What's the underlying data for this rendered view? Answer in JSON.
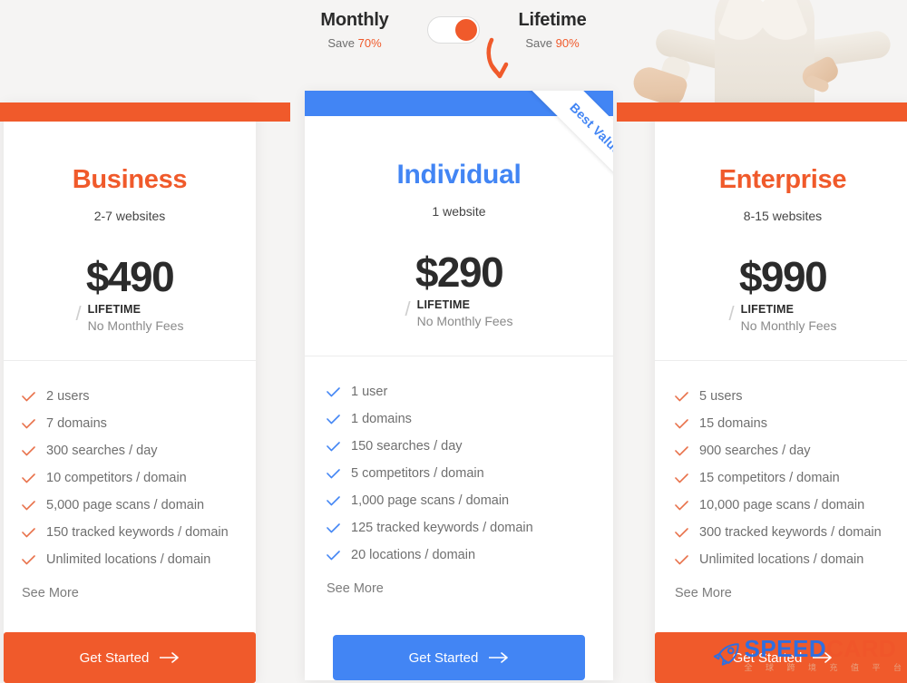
{
  "header": {
    "monthly": {
      "name": "Monthly",
      "save_prefix": "Save ",
      "save_pct": "70%"
    },
    "lifetime": {
      "name": "Lifetime",
      "save_prefix": "Save ",
      "save_pct": "90%"
    },
    "toggle_state": "lifetime"
  },
  "colors": {
    "orange": "#f05a2b",
    "blue": "#4285f4",
    "page_bg": "#f5f4f3",
    "card_bg": "#ffffff",
    "feature_text": "#6f6f6f"
  },
  "ribbon": {
    "label": "Best Value"
  },
  "cards": [
    {
      "name": "Business",
      "websites": "2-7 websites",
      "price": "$490",
      "slash": "/",
      "term": "LIFETIME",
      "term_note": "No Monthly Fees",
      "features": [
        "2 users",
        "7 domains",
        "300 searches / day",
        "10 competitors / domain",
        "5,000 page scans / domain",
        "150 tracked keywords / domain",
        "Unlimited locations / domain"
      ],
      "see_more": "See More",
      "cta": "Get Started",
      "cta_icon": "arrow-right-icon"
    },
    {
      "name": "Individual",
      "websites": "1 website",
      "price": "$290",
      "slash": "/",
      "term": "LIFETIME",
      "term_note": "No Monthly Fees",
      "features": [
        "1 user",
        "1 domains",
        "150 searches / day",
        "5 competitors / domain",
        "1,000 page scans / domain",
        "125 tracked keywords / domain",
        "20 locations / domain"
      ],
      "see_more": "See More",
      "cta": "Get Started",
      "cta_icon": "arrow-right-icon"
    },
    {
      "name": "Enterprise",
      "websites": "8-15 websites",
      "price": "$990",
      "slash": "/",
      "term": "LIFETIME",
      "term_note": "No Monthly Fees",
      "features": [
        "5 users",
        "15 domains",
        "900 searches / day",
        "15 competitors / domain",
        "10,000 page scans / domain",
        "300 tracked keywords / domain",
        "Unlimited locations / domain"
      ],
      "see_more": "See More",
      "cta": "Get Started",
      "cta_icon": "arrow-right-icon"
    }
  ],
  "watermark": {
    "part1": "SPEED",
    "part2": "CARD",
    "subtitle": "全 球 跨 境 充 值 平 台"
  }
}
